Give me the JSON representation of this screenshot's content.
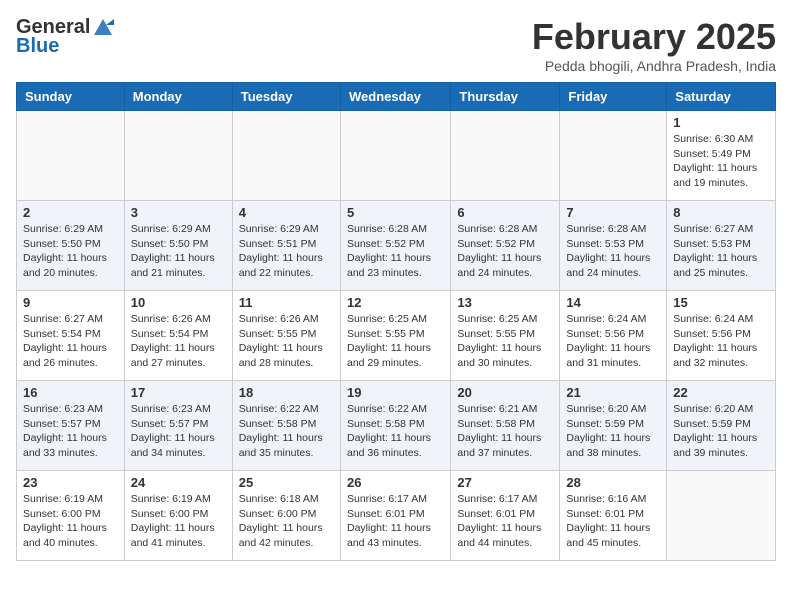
{
  "logo": {
    "general": "General",
    "blue": "Blue"
  },
  "title": "February 2025",
  "subtitle": "Pedda bhogili, Andhra Pradesh, India",
  "days_of_week": [
    "Sunday",
    "Monday",
    "Tuesday",
    "Wednesday",
    "Thursday",
    "Friday",
    "Saturday"
  ],
  "weeks": [
    [
      {
        "day": "",
        "info": ""
      },
      {
        "day": "",
        "info": ""
      },
      {
        "day": "",
        "info": ""
      },
      {
        "day": "",
        "info": ""
      },
      {
        "day": "",
        "info": ""
      },
      {
        "day": "",
        "info": ""
      },
      {
        "day": "1",
        "info": "Sunrise: 6:30 AM\nSunset: 5:49 PM\nDaylight: 11 hours and 19 minutes."
      }
    ],
    [
      {
        "day": "2",
        "info": "Sunrise: 6:29 AM\nSunset: 5:50 PM\nDaylight: 11 hours and 20 minutes."
      },
      {
        "day": "3",
        "info": "Sunrise: 6:29 AM\nSunset: 5:50 PM\nDaylight: 11 hours and 21 minutes."
      },
      {
        "day": "4",
        "info": "Sunrise: 6:29 AM\nSunset: 5:51 PM\nDaylight: 11 hours and 22 minutes."
      },
      {
        "day": "5",
        "info": "Sunrise: 6:28 AM\nSunset: 5:52 PM\nDaylight: 11 hours and 23 minutes."
      },
      {
        "day": "6",
        "info": "Sunrise: 6:28 AM\nSunset: 5:52 PM\nDaylight: 11 hours and 24 minutes."
      },
      {
        "day": "7",
        "info": "Sunrise: 6:28 AM\nSunset: 5:53 PM\nDaylight: 11 hours and 24 minutes."
      },
      {
        "day": "8",
        "info": "Sunrise: 6:27 AM\nSunset: 5:53 PM\nDaylight: 11 hours and 25 minutes."
      }
    ],
    [
      {
        "day": "9",
        "info": "Sunrise: 6:27 AM\nSunset: 5:54 PM\nDaylight: 11 hours and 26 minutes."
      },
      {
        "day": "10",
        "info": "Sunrise: 6:26 AM\nSunset: 5:54 PM\nDaylight: 11 hours and 27 minutes."
      },
      {
        "day": "11",
        "info": "Sunrise: 6:26 AM\nSunset: 5:55 PM\nDaylight: 11 hours and 28 minutes."
      },
      {
        "day": "12",
        "info": "Sunrise: 6:25 AM\nSunset: 5:55 PM\nDaylight: 11 hours and 29 minutes."
      },
      {
        "day": "13",
        "info": "Sunrise: 6:25 AM\nSunset: 5:55 PM\nDaylight: 11 hours and 30 minutes."
      },
      {
        "day": "14",
        "info": "Sunrise: 6:24 AM\nSunset: 5:56 PM\nDaylight: 11 hours and 31 minutes."
      },
      {
        "day": "15",
        "info": "Sunrise: 6:24 AM\nSunset: 5:56 PM\nDaylight: 11 hours and 32 minutes."
      }
    ],
    [
      {
        "day": "16",
        "info": "Sunrise: 6:23 AM\nSunset: 5:57 PM\nDaylight: 11 hours and 33 minutes."
      },
      {
        "day": "17",
        "info": "Sunrise: 6:23 AM\nSunset: 5:57 PM\nDaylight: 11 hours and 34 minutes."
      },
      {
        "day": "18",
        "info": "Sunrise: 6:22 AM\nSunset: 5:58 PM\nDaylight: 11 hours and 35 minutes."
      },
      {
        "day": "19",
        "info": "Sunrise: 6:22 AM\nSunset: 5:58 PM\nDaylight: 11 hours and 36 minutes."
      },
      {
        "day": "20",
        "info": "Sunrise: 6:21 AM\nSunset: 5:58 PM\nDaylight: 11 hours and 37 minutes."
      },
      {
        "day": "21",
        "info": "Sunrise: 6:20 AM\nSunset: 5:59 PM\nDaylight: 11 hours and 38 minutes."
      },
      {
        "day": "22",
        "info": "Sunrise: 6:20 AM\nSunset: 5:59 PM\nDaylight: 11 hours and 39 minutes."
      }
    ],
    [
      {
        "day": "23",
        "info": "Sunrise: 6:19 AM\nSunset: 6:00 PM\nDaylight: 11 hours and 40 minutes."
      },
      {
        "day": "24",
        "info": "Sunrise: 6:19 AM\nSunset: 6:00 PM\nDaylight: 11 hours and 41 minutes."
      },
      {
        "day": "25",
        "info": "Sunrise: 6:18 AM\nSunset: 6:00 PM\nDaylight: 11 hours and 42 minutes."
      },
      {
        "day": "26",
        "info": "Sunrise: 6:17 AM\nSunset: 6:01 PM\nDaylight: 11 hours and 43 minutes."
      },
      {
        "day": "27",
        "info": "Sunrise: 6:17 AM\nSunset: 6:01 PM\nDaylight: 11 hours and 44 minutes."
      },
      {
        "day": "28",
        "info": "Sunrise: 6:16 AM\nSunset: 6:01 PM\nDaylight: 11 hours and 45 minutes."
      },
      {
        "day": "",
        "info": ""
      }
    ]
  ]
}
